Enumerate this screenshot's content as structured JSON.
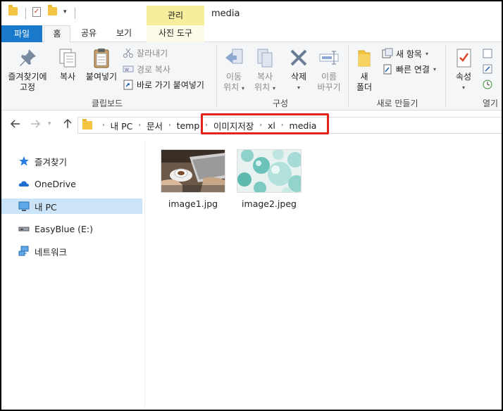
{
  "window": {
    "title": "media",
    "context_tab_label": "관리"
  },
  "ribbon_tabs": [
    {
      "label": "파일"
    },
    {
      "label": "홈"
    },
    {
      "label": "공유"
    },
    {
      "label": "보기"
    },
    {
      "label": "사진 도구"
    }
  ],
  "ribbon": {
    "clipboard": {
      "pin_label_line1": "즐겨찾기에",
      "pin_label_line2": "고정",
      "copy_label": "복사",
      "paste_label": "붙여넣기",
      "cut_label": "잘라내기",
      "copy_path_label": "경로 복사",
      "paste_shortcut_label": "바로 가기 붙여넣기",
      "group_label": "클립보드"
    },
    "organize": {
      "move_line1": "이동",
      "move_line2": "위치",
      "copyto_line1": "복사",
      "copyto_line2": "위치",
      "delete_label": "삭제",
      "rename_line1": "이름",
      "rename_line2": "바꾸기",
      "group_label": "구성"
    },
    "new": {
      "new_folder_line1": "새",
      "new_folder_line2": "폴더",
      "new_item_label": "새 항목",
      "easy_access_label": "빠른 연결",
      "group_label": "새로 만들기"
    },
    "open": {
      "properties_label": "속성",
      "group_label": "열기"
    }
  },
  "address_bar": {
    "breadcrumbs": [
      "내 PC",
      "문서",
      "temp",
      "이미지저장",
      "xl",
      "media"
    ]
  },
  "nav_pane": {
    "items": [
      {
        "label": "즐겨찾기",
        "icon": "star-icon"
      },
      {
        "label": "OneDrive",
        "icon": "cloud-icon"
      },
      {
        "label": "내 PC",
        "icon": "computer-icon"
      },
      {
        "label": "EasyBlue (E:)",
        "icon": "drive-icon"
      },
      {
        "label": "네트워크",
        "icon": "network-icon"
      }
    ]
  },
  "files": [
    {
      "name": "image1.jpg"
    },
    {
      "name": "image2.jpeg"
    }
  ],
  "colors": {
    "file_tab": "#1979ca",
    "context_tab": "#f6ee9d",
    "selection": "#cce4f7",
    "highlight_box": "#e2231a"
  }
}
